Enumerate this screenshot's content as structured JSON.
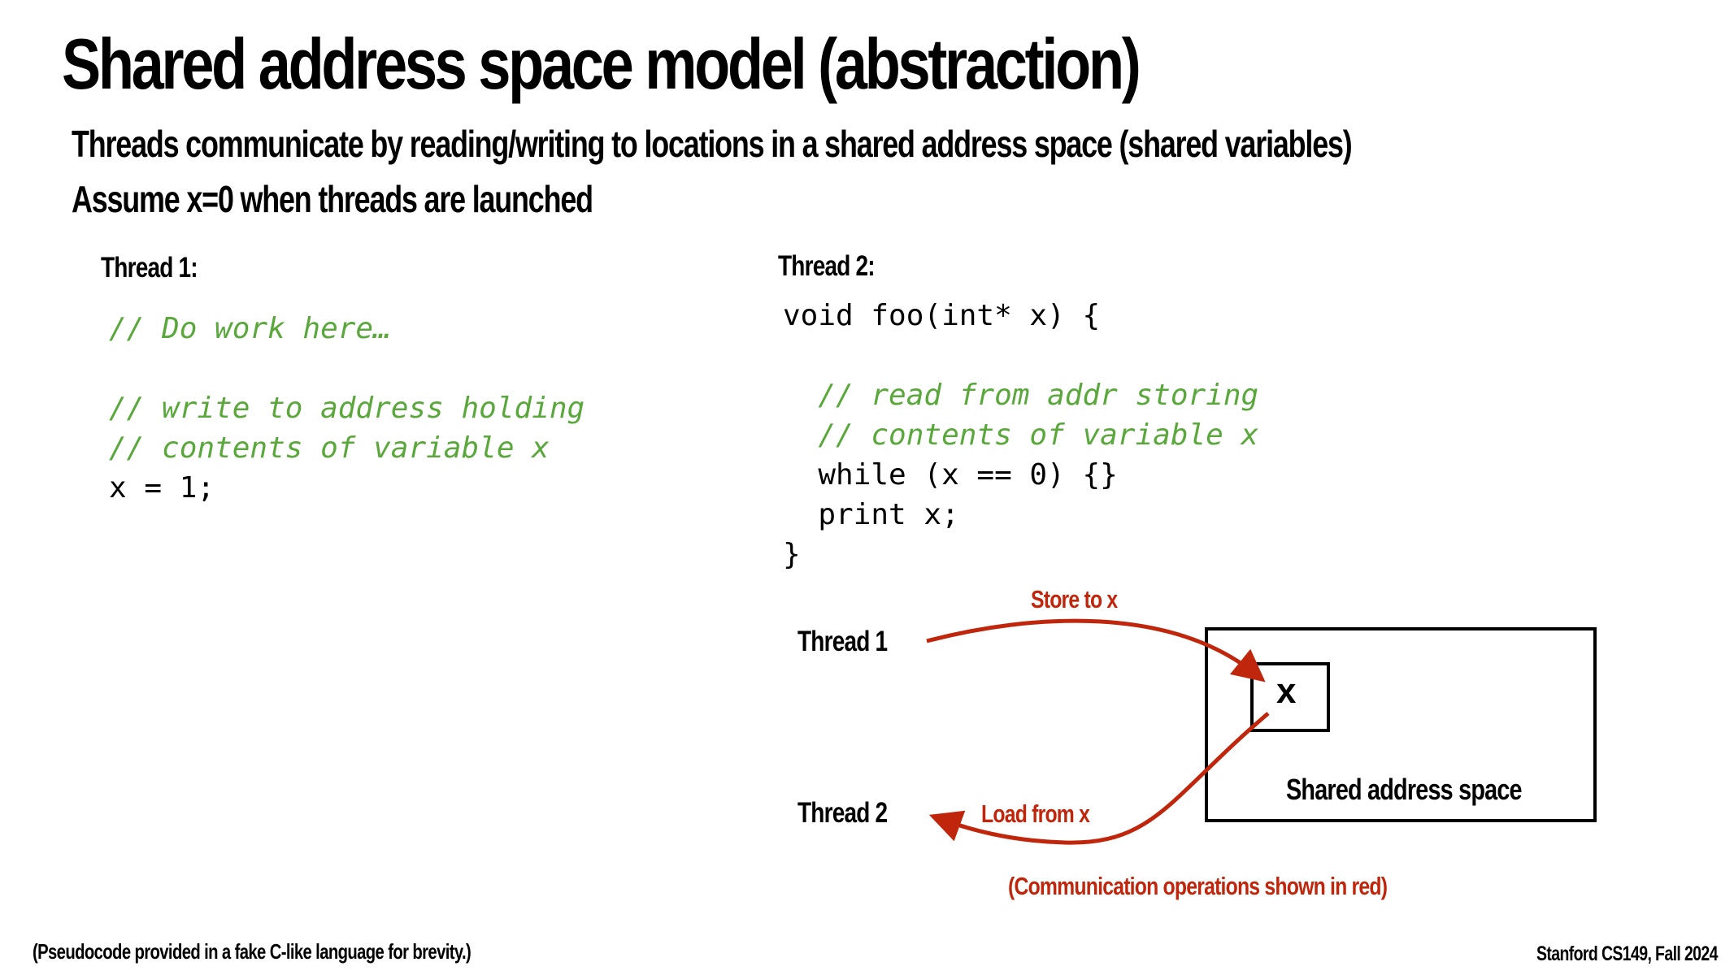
{
  "slide": {
    "title": "Shared address space model (abstraction)",
    "subtitle_lines": [
      "Threads communicate by reading/writing to locations in a shared address space (shared variables)",
      "Assume x=0 when threads are launched"
    ],
    "thread1": {
      "label": "Thread 1:",
      "code": [
        {
          "text": "// Do work here…",
          "kind": "comment"
        },
        {
          "text": "",
          "kind": "blank"
        },
        {
          "text": "// write to address holding",
          "kind": "comment"
        },
        {
          "text": "// contents of variable x",
          "kind": "comment"
        },
        {
          "text": "x = 1;",
          "kind": "code"
        }
      ]
    },
    "thread2": {
      "label": "Thread 2:",
      "code": [
        {
          "text": "void foo(int* x) {",
          "kind": "code"
        },
        {
          "text": "",
          "kind": "blank"
        },
        {
          "text": "  // read from addr storing",
          "kind": "comment"
        },
        {
          "text": "  // contents of variable x",
          "kind": "comment"
        },
        {
          "text": "  while (x == 0) {}",
          "kind": "code"
        },
        {
          "text": "  print x;",
          "kind": "code"
        },
        {
          "text": "}",
          "kind": "code"
        }
      ]
    },
    "diagram": {
      "thread1_label": "Thread 1",
      "thread2_label": "Thread 2",
      "store_label": "Store to x",
      "load_label": "Load from x",
      "variable_label": "x",
      "address_space_label": "Shared address space",
      "caption": "(Communication operations shown in red)",
      "arrow_color": "#c0260c"
    },
    "footer_left": "(Pseudocode provided in a fake C-like language for brevity.)",
    "footer_right": "Stanford CS149, Fall 2024"
  }
}
